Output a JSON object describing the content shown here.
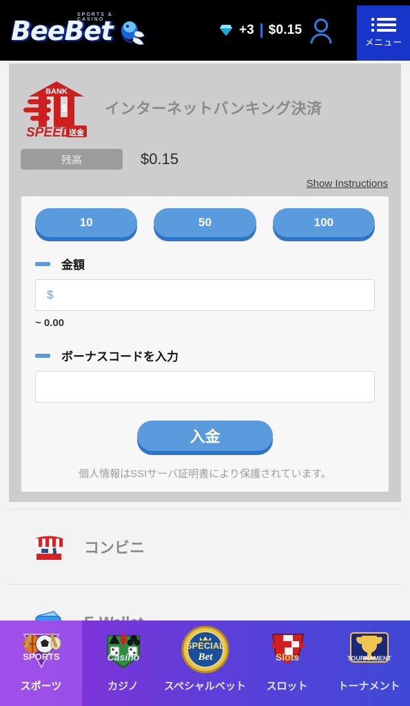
{
  "header": {
    "logo_text": "BeeBet",
    "logo_tagline": "SPORTS & CASINO",
    "diamond_icon": "diamond-icon",
    "diamond_count": "+3",
    "balance": "$0.15",
    "user_icon": "user-icon",
    "menu_icon": "hamburger-list-icon",
    "menu_label": "メニュー"
  },
  "payment": {
    "brand_logo": {
      "bank_word": "BANK",
      "dollar": "$",
      "speed_word": "SPEED",
      "speed_suffix": "送金"
    },
    "title": "インターネットバンキング決済",
    "balance_label": "残高",
    "balance_value": "$0.15",
    "instructions_link": "Show Instructions",
    "quick_amounts": [
      "10",
      "50",
      "100"
    ],
    "amount_label": "金額",
    "amount_value": "",
    "amount_placeholder": "$",
    "approx_value": "~ 0.00",
    "bonus_label": "ボーナスコードを入力",
    "bonus_value": "",
    "bonus_placeholder": "",
    "submit_label": "入金",
    "secure_note": "個人情報はSSIサーバ証明書により保護されています。"
  },
  "methods": [
    {
      "icon": "convenience-store-icon",
      "label": "コンビニ"
    },
    {
      "icon": "wallet-icon",
      "label": "E-Wallet"
    }
  ],
  "bottom_nav": [
    {
      "icon": "sports-icon",
      "label": "スポーツ",
      "badge": "SPORTS"
    },
    {
      "icon": "casino-icon",
      "label": "カジノ",
      "badge": "Casino"
    },
    {
      "icon": "special-bet-icon",
      "label": "スペシャルベット",
      "badge": "SPECIAL Bet"
    },
    {
      "icon": "slots-icon",
      "label": "スロット",
      "badge": "Slots"
    },
    {
      "icon": "tournament-icon",
      "label": "トーナメント",
      "badge": "TOURNAMENT"
    }
  ],
  "colors": {
    "header_bg": "#000000",
    "menu_blue": "#1836c9",
    "accent_blue": "#5a9bdd",
    "accent_blue_dark": "#2f74c6",
    "card_gray": "#cdcdcd",
    "brand_red": "#cc1f1f",
    "nav_gradient_start": "#8b33d9",
    "nav_gradient_end": "#3f49d6"
  }
}
